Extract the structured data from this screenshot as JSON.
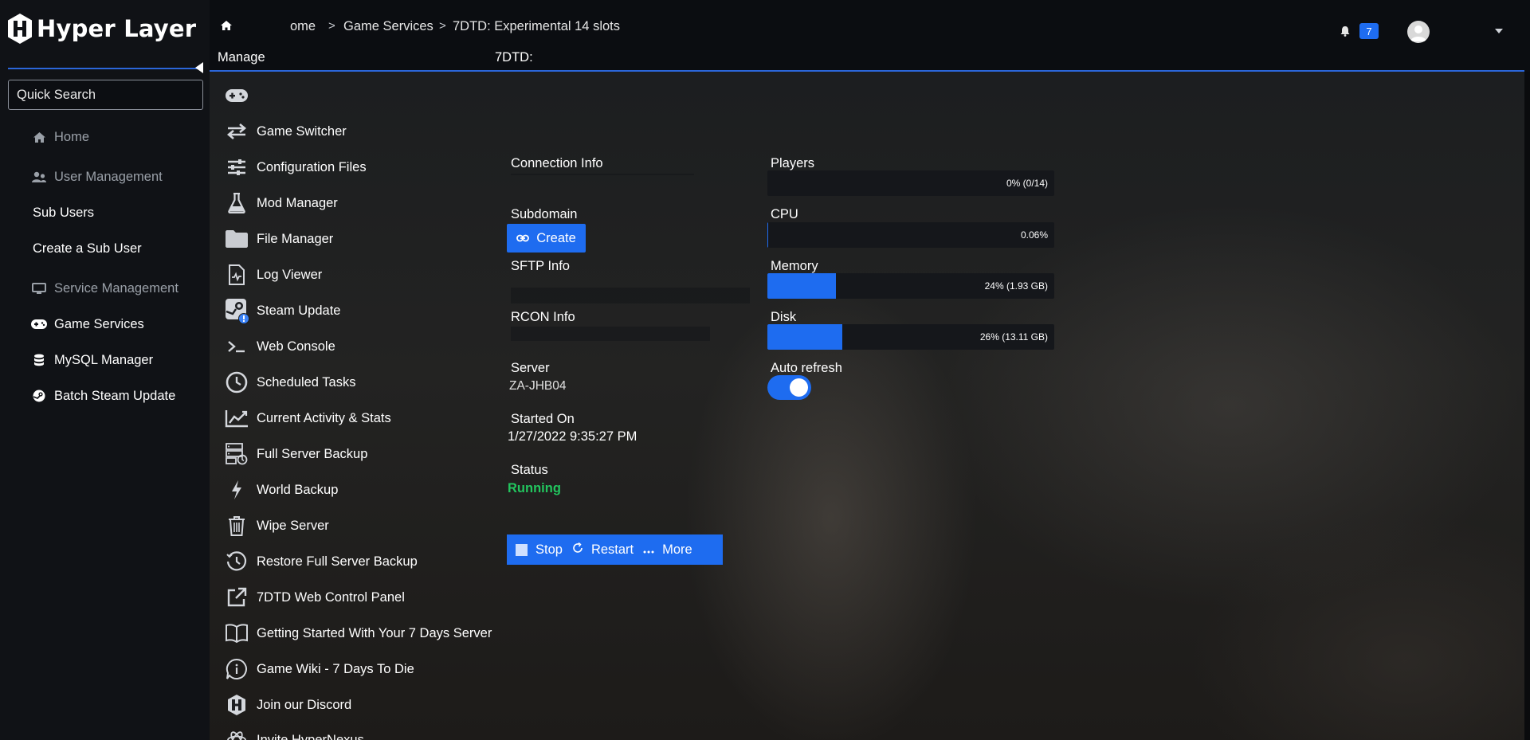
{
  "brand": {
    "name": "Hyper Layer",
    "accent": "#1e6cf0",
    "rule": "#2b66d9"
  },
  "sidebar": {
    "search_placeholder": "Quick Search",
    "items": [
      {
        "label": "Home",
        "icon": "home-icon",
        "style": "muted"
      },
      {
        "label": "User Management",
        "icon": "users-icon",
        "style": "muted"
      },
      {
        "label": "Sub Users",
        "style": "sub"
      },
      {
        "label": "Create a Sub User",
        "style": "sub"
      },
      {
        "label": "Service Management",
        "icon": "monitor-icon",
        "style": "muted"
      },
      {
        "label": "Game Services",
        "icon": "gamepad-icon",
        "style": "main"
      },
      {
        "label": "MySQL Manager",
        "icon": "database-icon",
        "style": "main"
      },
      {
        "label": "Batch Steam Update",
        "icon": "steam-icon",
        "style": "main"
      }
    ]
  },
  "header": {
    "breadcrumb": [
      "ome",
      "Game Services",
      "7DTD: Experimental 14 slots"
    ],
    "notification_count": "7",
    "manage_label": "Manage",
    "service_label": "7DTD:"
  },
  "manage_menu": [
    {
      "label": "",
      "icon": "gamepad-icon"
    },
    {
      "label": "Game Switcher",
      "icon": "swap-arrows-icon"
    },
    {
      "label": "Configuration Files",
      "icon": "sliders-icon"
    },
    {
      "label": "Mod Manager",
      "icon": "flask-icon"
    },
    {
      "label": "File Manager",
      "icon": "folder-icon"
    },
    {
      "label": "Log Viewer",
      "icon": "log-file-icon"
    },
    {
      "label": "Steam Update",
      "icon": "steam-update-icon"
    },
    {
      "label": "Web Console",
      "icon": "terminal-icon"
    },
    {
      "label": "Scheduled Tasks",
      "icon": "clock-icon"
    },
    {
      "label": "Current Activity & Stats",
      "icon": "chart-line-icon"
    },
    {
      "label": "Full Server Backup",
      "icon": "server-backup-icon"
    },
    {
      "label": "World Backup",
      "icon": "bolt-icon"
    },
    {
      "label": "Wipe Server",
      "icon": "trash-icon"
    },
    {
      "label": "Restore Full Server Backup",
      "icon": "history-icon"
    },
    {
      "label": "7DTD Web Control Panel",
      "icon": "external-link-icon"
    },
    {
      "label": "Getting Started With Your 7 Days Server",
      "icon": "book-icon"
    },
    {
      "label": "Game Wiki - 7 Days To Die",
      "icon": "info-bubble-icon"
    },
    {
      "label": "Join our Discord",
      "icon": "hyperlayer-icon"
    },
    {
      "label": "Invite HyperNexus",
      "icon": "atom-icon"
    }
  ],
  "info": {
    "connection_label": "Connection Info",
    "subdomain_label": "Subdomain",
    "create_label": "Create",
    "sftp_label": "SFTP Info",
    "rcon_label": "RCON Info",
    "server_label": "Server",
    "server_value": "ZA-JHB04",
    "started_label": "Started On",
    "started_value": "1/27/2022 9:35:27 PM",
    "status_label": "Status",
    "status_value": "Running",
    "status_color": "#22c55e"
  },
  "stats": {
    "players": {
      "label": "Players",
      "text": "0% (0/14)",
      "fraction": 0.0
    },
    "cpu": {
      "label": "CPU",
      "text": "0.06%",
      "fraction": 0.0006
    },
    "memory": {
      "label": "Memory",
      "text": "24% (1.93 GB)",
      "fraction": 0.24
    },
    "disk": {
      "label": "Disk",
      "text": "26% (13.11 GB)",
      "fraction": 0.26
    },
    "auto_refresh_label": "Auto refresh",
    "auto_refresh_on": true
  },
  "actions": {
    "stop": "Stop",
    "restart": "Restart",
    "more": "More"
  }
}
